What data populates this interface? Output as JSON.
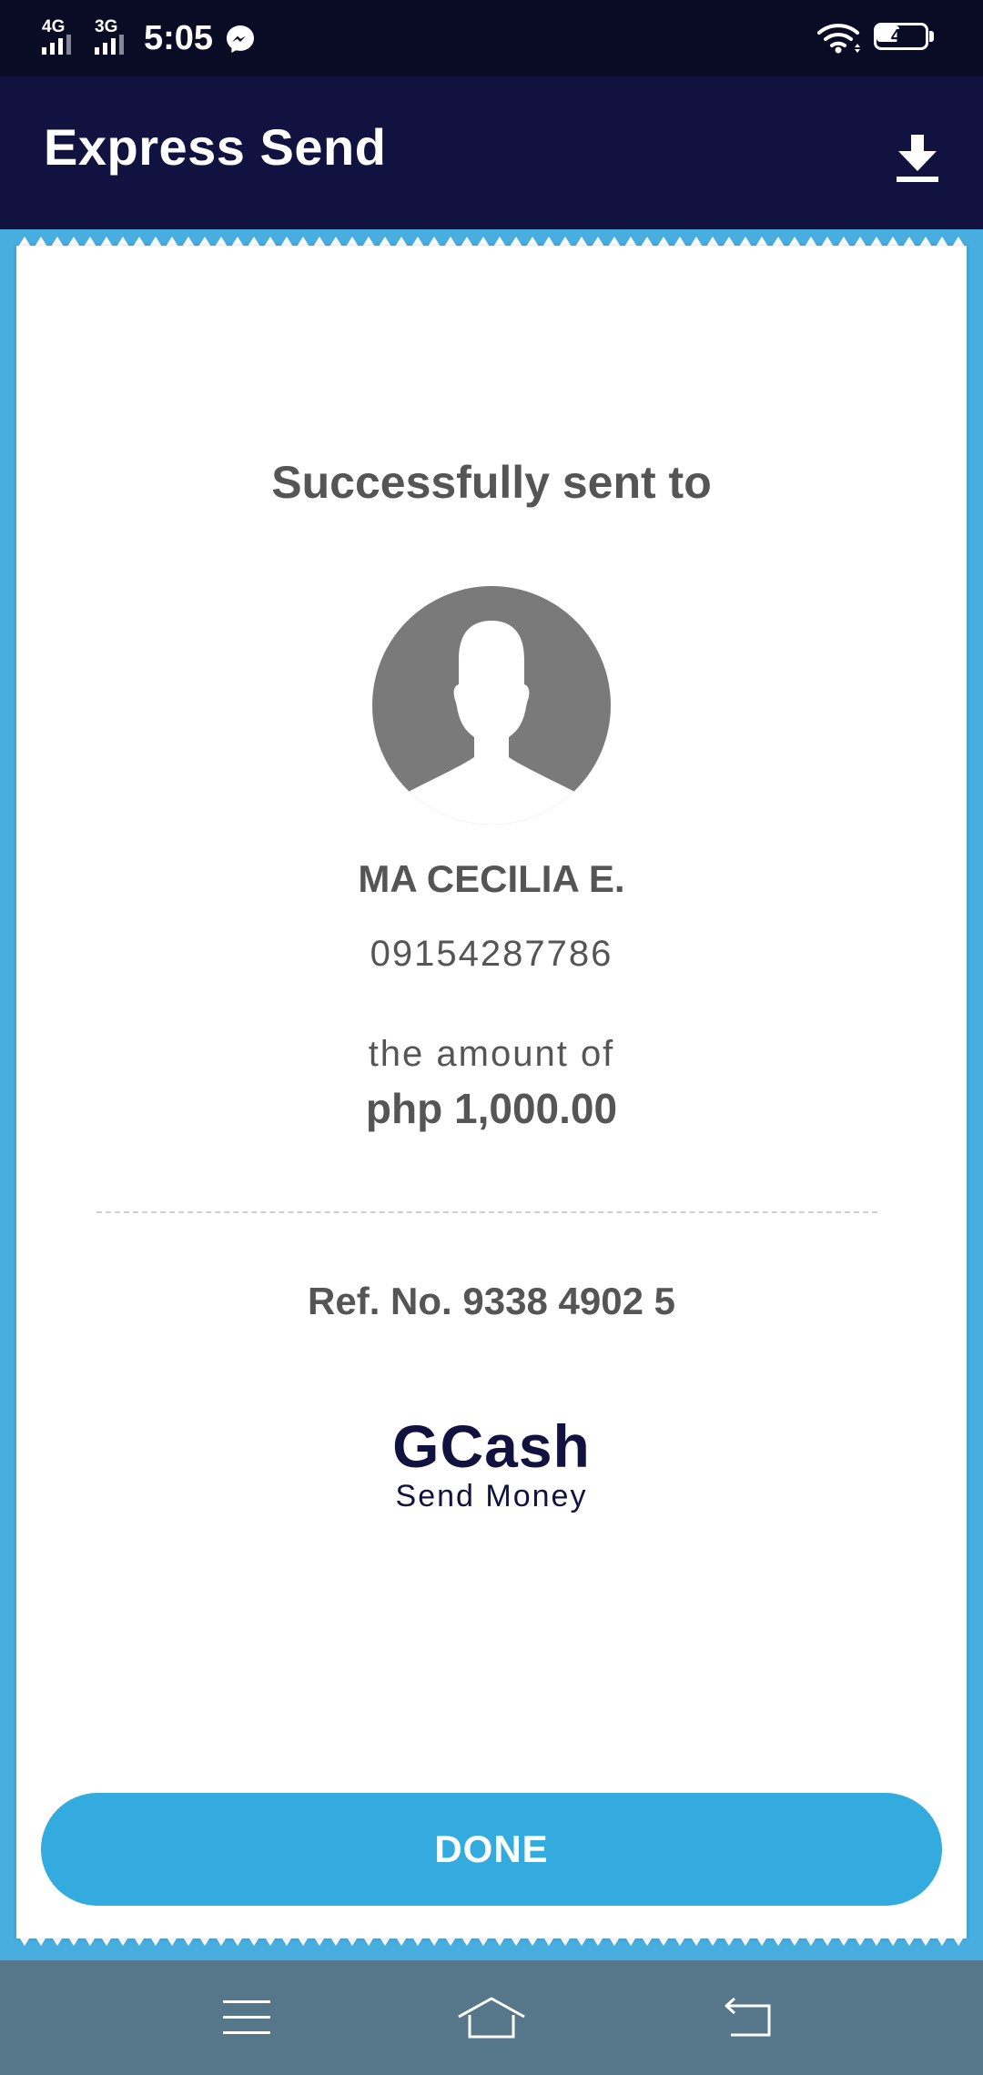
{
  "status_bar": {
    "network_1": "4G",
    "network_2": "3G",
    "time": "5:05",
    "battery_level": "47",
    "battery_fraction": 0.47,
    "icons": [
      "signal-icon",
      "messenger-icon",
      "wifi-icon",
      "battery-icon"
    ]
  },
  "app_bar": {
    "title": "Express Send",
    "action_icon": "download-icon"
  },
  "receipt": {
    "heading": "Successfully sent to",
    "avatar_icon": "person-silhouette-icon",
    "recipient_name": "MA CECILIA E.",
    "recipient_number": "09154287786",
    "amount_label": "the amount of",
    "amount": "php 1,000.00",
    "reference": "Ref. No. 9338 4902 5",
    "brand_name": "GCash",
    "brand_subtitle": "Send Money",
    "done_label": "DONE"
  },
  "nav_bar": {
    "icons": [
      "menu-icon",
      "home-icon",
      "back-icon"
    ]
  },
  "colors": {
    "status_bar_bg": "#0a0c26",
    "app_bar_bg": "#11123f",
    "page_bg": "#48aee0",
    "button_bg": "#33abdf",
    "text_gray": "#555555",
    "brand_navy": "#11123f",
    "nav_bar_bg": "#557789"
  }
}
